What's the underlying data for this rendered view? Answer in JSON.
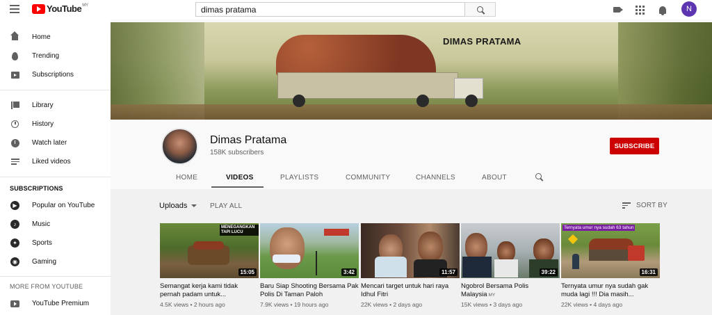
{
  "topbar": {
    "logo_text": "YouTube",
    "region": "MY",
    "search_value": "dimas pratama",
    "avatar_letter": "N"
  },
  "sidebar": {
    "main": [
      {
        "label": "Home",
        "icon": "home-icon"
      },
      {
        "label": "Trending",
        "icon": "trending-icon"
      },
      {
        "label": "Subscriptions",
        "icon": "subscriptions-icon"
      }
    ],
    "library": [
      {
        "label": "Library",
        "icon": "library-icon"
      },
      {
        "label": "History",
        "icon": "history-icon"
      },
      {
        "label": "Watch later",
        "icon": "watch-later-icon"
      },
      {
        "label": "Liked videos",
        "icon": "liked-videos-icon"
      }
    ],
    "subscriptions_heading": "SUBSCRIPTIONS",
    "subscriptions": [
      {
        "label": "Popular on YouTube",
        "icon": "popular-icon"
      },
      {
        "label": "Music",
        "icon": "music-icon"
      },
      {
        "label": "Sports",
        "icon": "sports-icon"
      },
      {
        "label": "Gaming",
        "icon": "gaming-icon"
      }
    ],
    "more_heading": "MORE FROM YOUTUBE",
    "more": [
      {
        "label": "YouTube Premium",
        "icon": "youtube-premium-icon"
      }
    ]
  },
  "banner": {
    "title": "DIMAS PRATAMA"
  },
  "channel": {
    "name": "Dimas Pratama",
    "subscribers": "158K subscribers",
    "subscribe_label": "SUBSCRIBE",
    "tabs": [
      "HOME",
      "VIDEOS",
      "PLAYLISTS",
      "COMMUNITY",
      "CHANNELS",
      "ABOUT"
    ],
    "active_tab": "VIDEOS"
  },
  "controls": {
    "uploads_label": "Uploads",
    "play_all_label": "PLAY ALL",
    "sort_label": "SORT BY"
  },
  "videos": [
    {
      "title": "Semangat kerja kami tidak pernah padam untuk...",
      "views": "4.5K views",
      "age": "2 hours ago",
      "duration": "15:05",
      "overlay": "MENEGANGKAN TAPI LUCU"
    },
    {
      "title": "Baru Siap Shooting Bersama Pak Polis Di Taman Paloh",
      "views": "7.9K views",
      "age": "19 hours ago",
      "duration": "3:42"
    },
    {
      "title": "Mencari target untuk hari raya Idhul Fitri",
      "views": "22K views",
      "age": "2 days ago",
      "duration": "11:57"
    },
    {
      "title": "Ngobrol Bersama Polis Malaysia",
      "title_badge": "MY",
      "views": "15K views",
      "age": "3 days ago",
      "duration": "39:22"
    },
    {
      "title": "Ternyata umur nya sudah gak muda lagi !!! Dia masih...",
      "views": "22K views",
      "age": "4 days ago",
      "duration": "16:31",
      "overlay": "Ternyata umur nya sudah 63 tahun"
    }
  ],
  "colors": {
    "subscribe": "#cc0000",
    "avatar": "#5e35b1",
    "logo_red": "#ff0000"
  }
}
